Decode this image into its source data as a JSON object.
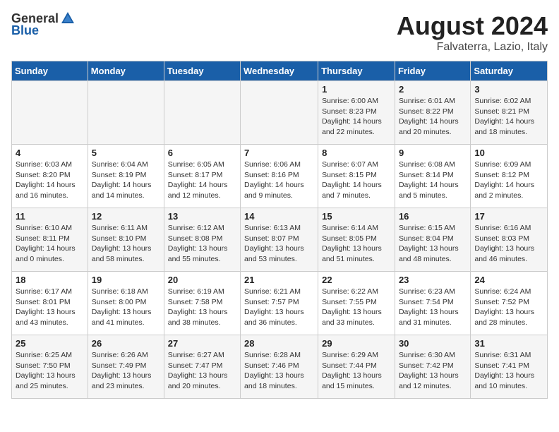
{
  "header": {
    "logo_general": "General",
    "logo_blue": "Blue",
    "title": "August 2024",
    "subtitle": "Falvaterra, Lazio, Italy"
  },
  "weekdays": [
    "Sunday",
    "Monday",
    "Tuesday",
    "Wednesday",
    "Thursday",
    "Friday",
    "Saturday"
  ],
  "weeks": [
    [
      {
        "day": "",
        "info": ""
      },
      {
        "day": "",
        "info": ""
      },
      {
        "day": "",
        "info": ""
      },
      {
        "day": "",
        "info": ""
      },
      {
        "day": "1",
        "info": "Sunrise: 6:00 AM\nSunset: 8:23 PM\nDaylight: 14 hours\nand 22 minutes."
      },
      {
        "day": "2",
        "info": "Sunrise: 6:01 AM\nSunset: 8:22 PM\nDaylight: 14 hours\nand 20 minutes."
      },
      {
        "day": "3",
        "info": "Sunrise: 6:02 AM\nSunset: 8:21 PM\nDaylight: 14 hours\nand 18 minutes."
      }
    ],
    [
      {
        "day": "4",
        "info": "Sunrise: 6:03 AM\nSunset: 8:20 PM\nDaylight: 14 hours\nand 16 minutes."
      },
      {
        "day": "5",
        "info": "Sunrise: 6:04 AM\nSunset: 8:19 PM\nDaylight: 14 hours\nand 14 minutes."
      },
      {
        "day": "6",
        "info": "Sunrise: 6:05 AM\nSunset: 8:17 PM\nDaylight: 14 hours\nand 12 minutes."
      },
      {
        "day": "7",
        "info": "Sunrise: 6:06 AM\nSunset: 8:16 PM\nDaylight: 14 hours\nand 9 minutes."
      },
      {
        "day": "8",
        "info": "Sunrise: 6:07 AM\nSunset: 8:15 PM\nDaylight: 14 hours\nand 7 minutes."
      },
      {
        "day": "9",
        "info": "Sunrise: 6:08 AM\nSunset: 8:14 PM\nDaylight: 14 hours\nand 5 minutes."
      },
      {
        "day": "10",
        "info": "Sunrise: 6:09 AM\nSunset: 8:12 PM\nDaylight: 14 hours\nand 2 minutes."
      }
    ],
    [
      {
        "day": "11",
        "info": "Sunrise: 6:10 AM\nSunset: 8:11 PM\nDaylight: 14 hours\nand 0 minutes."
      },
      {
        "day": "12",
        "info": "Sunrise: 6:11 AM\nSunset: 8:10 PM\nDaylight: 13 hours\nand 58 minutes."
      },
      {
        "day": "13",
        "info": "Sunrise: 6:12 AM\nSunset: 8:08 PM\nDaylight: 13 hours\nand 55 minutes."
      },
      {
        "day": "14",
        "info": "Sunrise: 6:13 AM\nSunset: 8:07 PM\nDaylight: 13 hours\nand 53 minutes."
      },
      {
        "day": "15",
        "info": "Sunrise: 6:14 AM\nSunset: 8:05 PM\nDaylight: 13 hours\nand 51 minutes."
      },
      {
        "day": "16",
        "info": "Sunrise: 6:15 AM\nSunset: 8:04 PM\nDaylight: 13 hours\nand 48 minutes."
      },
      {
        "day": "17",
        "info": "Sunrise: 6:16 AM\nSunset: 8:03 PM\nDaylight: 13 hours\nand 46 minutes."
      }
    ],
    [
      {
        "day": "18",
        "info": "Sunrise: 6:17 AM\nSunset: 8:01 PM\nDaylight: 13 hours\nand 43 minutes."
      },
      {
        "day": "19",
        "info": "Sunrise: 6:18 AM\nSunset: 8:00 PM\nDaylight: 13 hours\nand 41 minutes."
      },
      {
        "day": "20",
        "info": "Sunrise: 6:19 AM\nSunset: 7:58 PM\nDaylight: 13 hours\nand 38 minutes."
      },
      {
        "day": "21",
        "info": "Sunrise: 6:21 AM\nSunset: 7:57 PM\nDaylight: 13 hours\nand 36 minutes."
      },
      {
        "day": "22",
        "info": "Sunrise: 6:22 AM\nSunset: 7:55 PM\nDaylight: 13 hours\nand 33 minutes."
      },
      {
        "day": "23",
        "info": "Sunrise: 6:23 AM\nSunset: 7:54 PM\nDaylight: 13 hours\nand 31 minutes."
      },
      {
        "day": "24",
        "info": "Sunrise: 6:24 AM\nSunset: 7:52 PM\nDaylight: 13 hours\nand 28 minutes."
      }
    ],
    [
      {
        "day": "25",
        "info": "Sunrise: 6:25 AM\nSunset: 7:50 PM\nDaylight: 13 hours\nand 25 minutes."
      },
      {
        "day": "26",
        "info": "Sunrise: 6:26 AM\nSunset: 7:49 PM\nDaylight: 13 hours\nand 23 minutes."
      },
      {
        "day": "27",
        "info": "Sunrise: 6:27 AM\nSunset: 7:47 PM\nDaylight: 13 hours\nand 20 minutes."
      },
      {
        "day": "28",
        "info": "Sunrise: 6:28 AM\nSunset: 7:46 PM\nDaylight: 13 hours\nand 18 minutes."
      },
      {
        "day": "29",
        "info": "Sunrise: 6:29 AM\nSunset: 7:44 PM\nDaylight: 13 hours\nand 15 minutes."
      },
      {
        "day": "30",
        "info": "Sunrise: 6:30 AM\nSunset: 7:42 PM\nDaylight: 13 hours\nand 12 minutes."
      },
      {
        "day": "31",
        "info": "Sunrise: 6:31 AM\nSunset: 7:41 PM\nDaylight: 13 hours\nand 10 minutes."
      }
    ]
  ]
}
